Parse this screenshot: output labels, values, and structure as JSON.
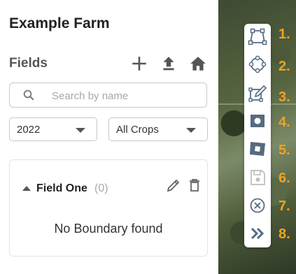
{
  "sidebar": {
    "title": "Example Farm",
    "fields_label": "Fields",
    "header_icons": [
      "plus-icon",
      "upload-icon",
      "home-icon"
    ],
    "search": {
      "placeholder": "Search by name",
      "value": ""
    },
    "year_select": {
      "value": "2022"
    },
    "crop_select": {
      "value": "All Crops"
    },
    "field_card": {
      "name": "Field One",
      "count": "(0)",
      "empty_message": "No Boundary found"
    }
  },
  "toolbar": {
    "tools": [
      {
        "icon": "draw-polygon-icon",
        "number": "1."
      },
      {
        "icon": "draw-circle-icon",
        "number": "2."
      },
      {
        "icon": "edit-shape-icon",
        "number": "3."
      },
      {
        "icon": "hole-shape-icon",
        "number": "4."
      },
      {
        "icon": "rotate-shape-icon",
        "number": "5."
      },
      {
        "icon": "save-icon",
        "number": "6."
      },
      {
        "icon": "cancel-icon",
        "number": "7."
      },
      {
        "icon": "collapse-icon",
        "number": "8."
      }
    ]
  },
  "colors": {
    "number_accent": "#f5a21b",
    "icon_primary": "#556b80",
    "icon_disabled": "#bfbfbf"
  }
}
